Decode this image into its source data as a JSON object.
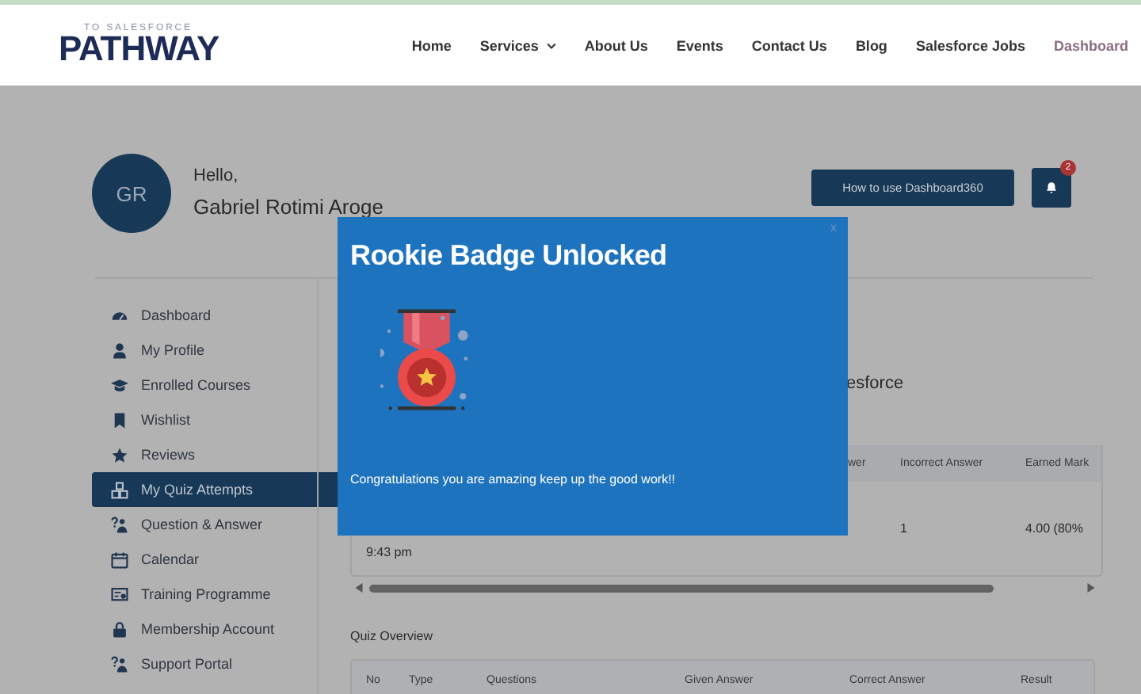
{
  "header": {
    "logo": {
      "tagline": "TO SALESFORCE",
      "name": "PATHWAY"
    },
    "nav": [
      {
        "label": "Home",
        "selected": false,
        "dropdown": false
      },
      {
        "label": "Services",
        "selected": false,
        "dropdown": true
      },
      {
        "label": "About Us",
        "selected": false,
        "dropdown": false
      },
      {
        "label": "Events",
        "selected": false,
        "dropdown": false
      },
      {
        "label": "Contact Us",
        "selected": false,
        "dropdown": false
      },
      {
        "label": "Blog",
        "selected": false,
        "dropdown": false
      },
      {
        "label": "Salesforce Jobs",
        "selected": false,
        "dropdown": false
      },
      {
        "label": "Dashboard",
        "selected": true,
        "dropdown": false
      }
    ]
  },
  "profile": {
    "initials": "GR",
    "greeting": "Hello,",
    "name": "Gabriel Rotimi Aroge",
    "help_button": "How to use Dashboard360",
    "notification_count": "2"
  },
  "sidebar": {
    "items": [
      {
        "label": "Dashboard",
        "selected": false
      },
      {
        "label": "My Profile",
        "selected": false
      },
      {
        "label": "Enrolled Courses",
        "selected": false
      },
      {
        "label": "Wishlist",
        "selected": false
      },
      {
        "label": "Reviews",
        "selected": false
      },
      {
        "label": "My Quiz Attempts",
        "selected": true
      },
      {
        "label": "Question & Answer",
        "selected": false
      },
      {
        "label": "Calendar",
        "selected": false
      },
      {
        "label": "Training Programme",
        "selected": false
      },
      {
        "label": "Membership Account",
        "selected": false
      },
      {
        "label": "Support Portal",
        "selected": false
      }
    ]
  },
  "content": {
    "heading_fragment": "esforce",
    "attempts_table": {
      "columns": [
        "",
        "wer",
        "Incorrect Answer",
        "Earned Mark"
      ],
      "rows": [
        {
          "cells": [
            "9:43 pm",
            "",
            "1",
            "4.00 (80%"
          ]
        }
      ]
    },
    "overview": {
      "title": "Quiz Overview",
      "columns": [
        "No",
        "Type",
        "Questions",
        "Given Answer",
        "Correct Answer",
        "Result"
      ]
    }
  },
  "modal": {
    "title": "Rookie Badge Unlocked",
    "message": "Congratulations you are amazing keep up the good work!!",
    "close": "x"
  }
}
